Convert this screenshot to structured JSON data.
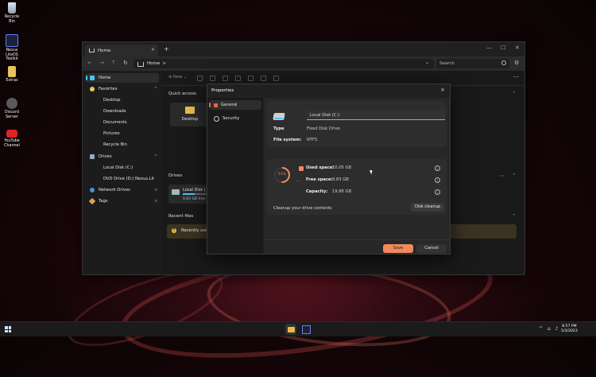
{
  "desktop": {
    "icons": [
      {
        "label": "Recycle Bin"
      },
      {
        "label": "Nexus LiteOS Toolkit"
      },
      {
        "label": "Extras"
      },
      {
        "label": "Discord Server"
      },
      {
        "label": "YouTube Channel"
      }
    ]
  },
  "explorer": {
    "tab_title": "Home",
    "tab_close": "×",
    "new_tab": "+",
    "address": "Home",
    "address_sep": ">",
    "search_placeholder": "Search",
    "toolbar_new": "New",
    "sidebar": [
      {
        "label": "Home"
      },
      {
        "label": "Favorites"
      },
      {
        "label": "Desktop"
      },
      {
        "label": "Downloads"
      },
      {
        "label": "Documents"
      },
      {
        "label": "Pictures"
      },
      {
        "label": "Recycle Bin"
      },
      {
        "label": "Drives"
      },
      {
        "label": "Local Disk (C:)"
      },
      {
        "label": "DVD Drive (D:) Nexus.Lit"
      },
      {
        "label": "Network Drives"
      },
      {
        "label": "Tags"
      }
    ],
    "sections": {
      "quick_access": "Quick access",
      "drives": "Drives",
      "recent_files": "Recent files"
    },
    "quick_access_tile": "Desktop",
    "drive_tile": {
      "name": "Local Disk (",
      "free": "9.83 GB free o",
      "used_fraction": 0.51
    },
    "recent_banner": "Recently use"
  },
  "properties": {
    "title": "Properties",
    "close": "×",
    "nav": [
      {
        "label": "General"
      },
      {
        "label": "Security"
      }
    ],
    "name_value": "Local Disk (C:)",
    "type_key": "Type",
    "type_value": "Fixed Disk Drive",
    "fs_key": "File system:",
    "fs_value": "NTFS",
    "usage_percent_label": "51%",
    "usage_fraction": 0.51,
    "dots": "...",
    "used_key": "Used space:",
    "used_value": "10.05 GB",
    "free_key": "Free space:",
    "free_value": "9.83 GB",
    "capacity_key": "Capacity:",
    "capacity_value": "19.88 GB",
    "info_glyph": "i",
    "cleanup_label": "Cleanup your drive contents",
    "cleanup_button": "Disk cleanup",
    "save_button": "Save",
    "cancel_button": "Cancel",
    "colors": {
      "accent": "#f08a5d",
      "used": "#f08a5d",
      "free": "#3a3a3a"
    }
  },
  "taskbar": {
    "time": "8:57 PM",
    "date": "5/3/2023"
  }
}
